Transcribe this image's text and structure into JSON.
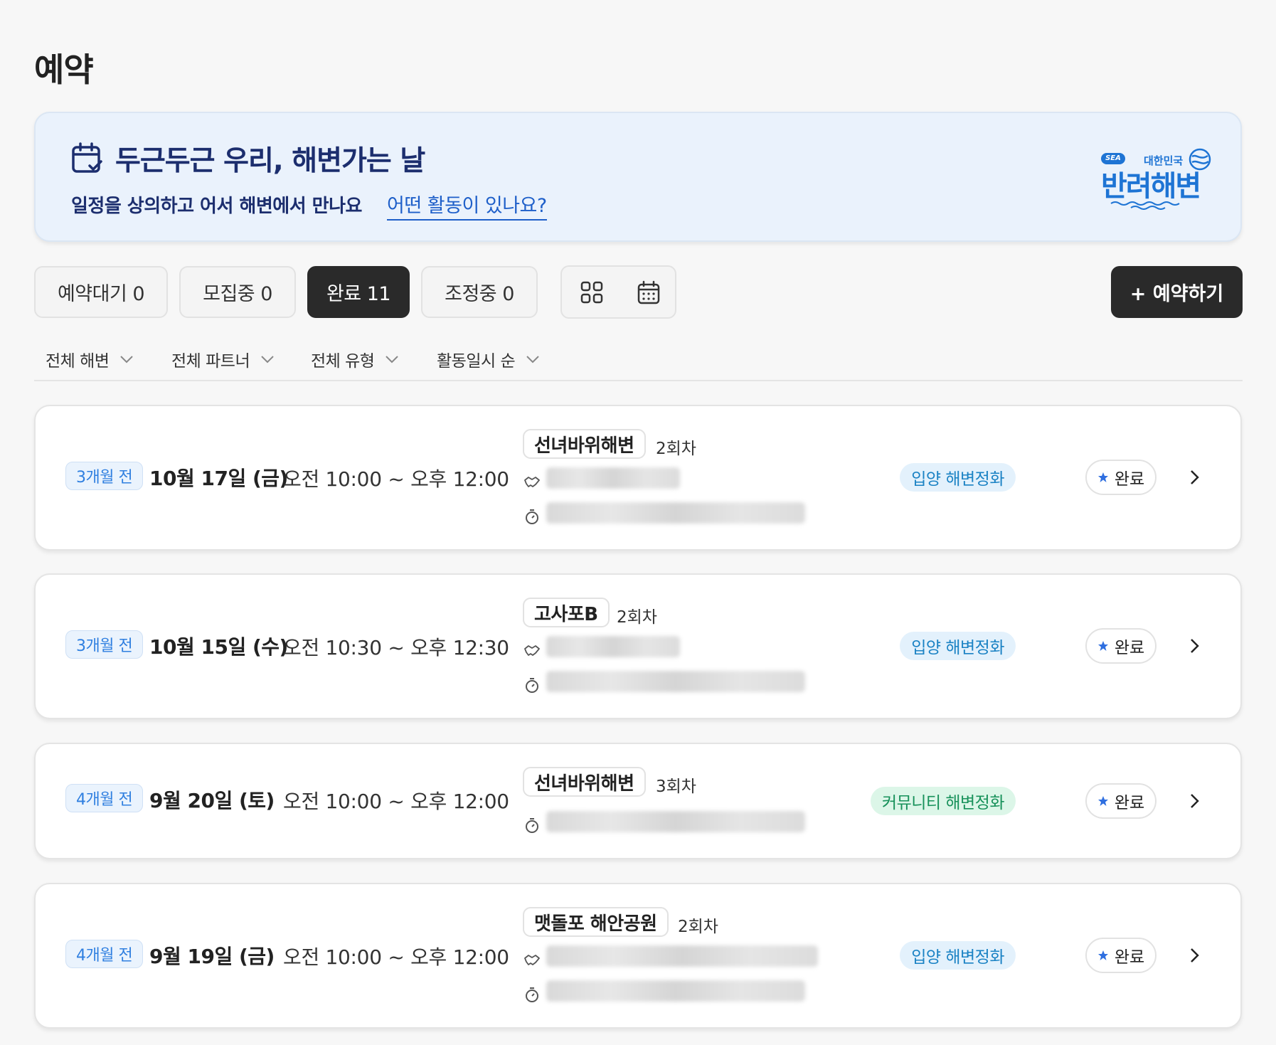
{
  "page": {
    "title": "예약"
  },
  "banner": {
    "headline": "두근두근 우리, 해변가는 날",
    "subtitle": "일정을 상의하고 어서 해변에서 만나요",
    "link": "어떤 활동이 있나요?",
    "logo": {
      "sea": "SEA",
      "top": "대한민국",
      "main": "반려해변"
    }
  },
  "tabs": [
    {
      "label": "예약대기 0"
    },
    {
      "label": "모집중 0"
    },
    {
      "label": "완료 11",
      "active": true
    },
    {
      "label": "조정중 0"
    }
  ],
  "view_toggle": {
    "options": [
      "grid-icon",
      "calendar-icon"
    ]
  },
  "reserve_button": {
    "label": "+ 예약하기"
  },
  "filters": [
    {
      "label": "전체 해변"
    },
    {
      "label": "전체 파트너"
    },
    {
      "label": "전체 유형"
    },
    {
      "label": "활동일시 순"
    }
  ],
  "reservations": [
    {
      "ago": "3개월 전",
      "date": "10월 17일 (금)",
      "time": "오전 10:00 ~ 오후 12:00",
      "beach": "선녀바위해변",
      "session": "2회차",
      "type": "입양 해변정화",
      "status": "완료",
      "has_partner": true
    },
    {
      "ago": "3개월 전",
      "date": "10월 15일 (수)",
      "time": "오전 10:30 ~ 오후 12:30",
      "beach": "고사포B",
      "session": "2회차",
      "type": "입양 해변정화",
      "status": "완료",
      "has_partner": true
    },
    {
      "ago": "4개월 전",
      "date": "9월 20일 (토)",
      "time": "오전 10:00 ~ 오후 12:00",
      "beach": "선녀바위해변",
      "session": "3회차",
      "type": "커뮤니티 해변정화",
      "status": "완료",
      "has_partner": false
    },
    {
      "ago": "4개월 전",
      "date": "9월 19일 (금)",
      "time": "오전 10:00 ~ 오후 12:00",
      "beach": "맷돌포 해안공원",
      "session": "2회차",
      "type": "입양 해변정화",
      "status": "완료",
      "has_partner": true
    }
  ],
  "colors": {
    "adopt_badge_bg": "#e3f1fc",
    "adopt_badge_text": "#1a82c4",
    "community_badge_bg": "#dcf6e8",
    "community_badge_text": "#17915a",
    "accent": "#2f7fe0",
    "dark": "#2a2a2a"
  }
}
